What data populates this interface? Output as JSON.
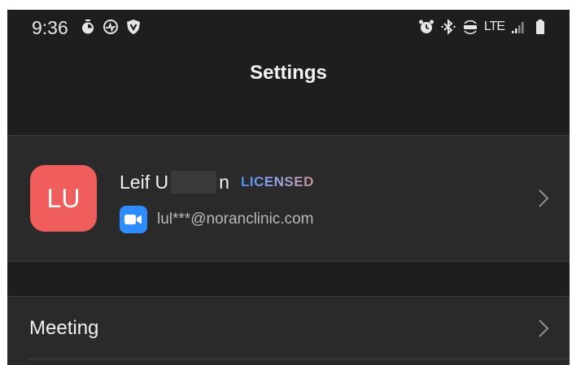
{
  "status_bar": {
    "time": "9:36",
    "network": "LTE",
    "left_icons": [
      "timer-icon",
      "activity-icon",
      "shield-icon"
    ],
    "right_icons": [
      "alarm-icon",
      "bluetooth-icon",
      "volte-icon",
      "signal-icon",
      "battery-icon"
    ]
  },
  "header": {
    "title": "Settings"
  },
  "profile": {
    "initials": "LU",
    "name_prefix": "Leif U",
    "name_suffix": "n",
    "license": "LICENSED",
    "email": "lul***@noranclinic.com",
    "avatar_color": "#ef5d5d",
    "zoom_icon_color": "#2d8cff"
  },
  "menu": {
    "items": [
      {
        "label": "Meeting"
      }
    ]
  },
  "colors": {
    "background": "#1e1e1e",
    "row_background": "#2a2a2a",
    "accent": "#4a90f0"
  }
}
